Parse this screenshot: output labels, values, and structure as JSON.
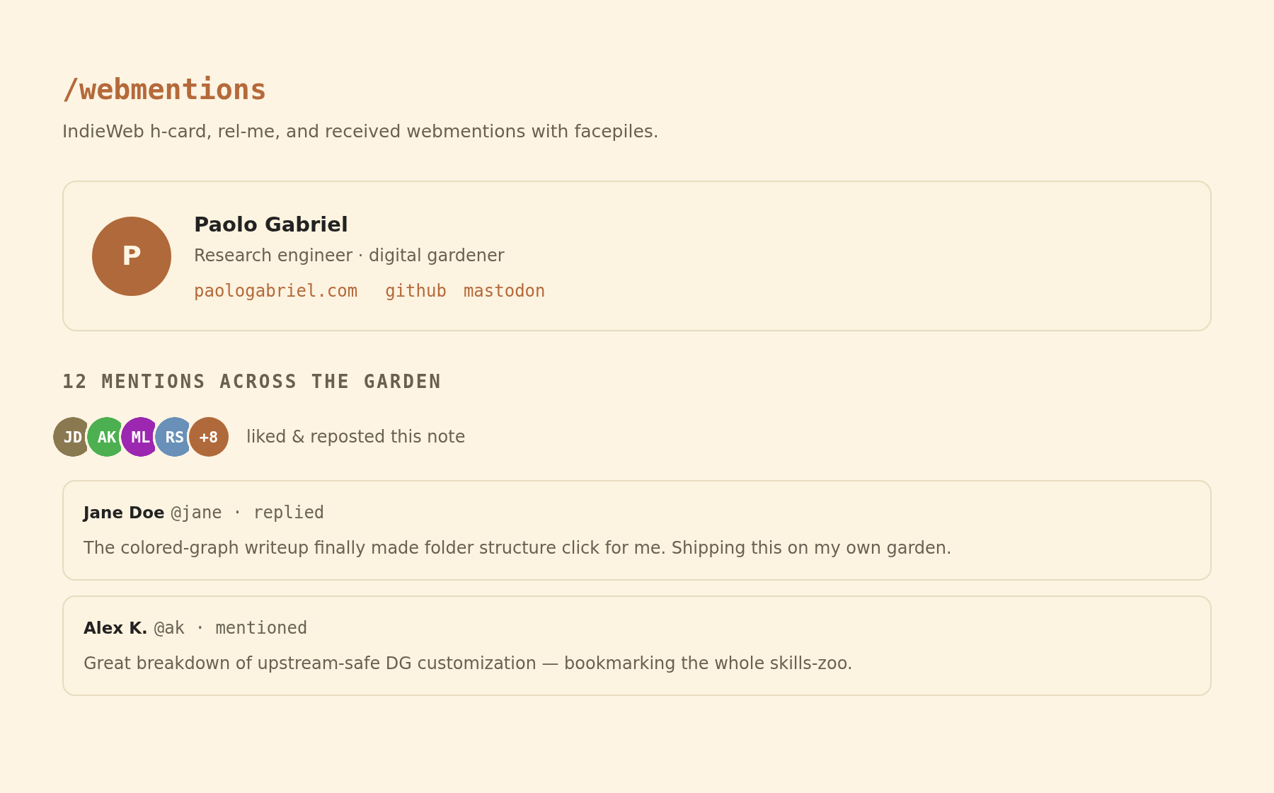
{
  "header": {
    "title": "/webmentions",
    "subtitle": "IndieWeb h-card, rel-me, and received webmentions with facepiles."
  },
  "h_card": {
    "avatar_initial": "P",
    "name": "Paolo Gabriel",
    "note": "Research engineer · digital gardener",
    "url": "paologabriel.com",
    "rel_me": [
      "github",
      "mastodon"
    ]
  },
  "mentions": {
    "heading": "12 MENTIONS ACROSS THE GARDEN",
    "facepile": {
      "avatars": [
        {
          "initials": "JD",
          "color": "#8a7850"
        },
        {
          "initials": "AK",
          "color": "#4caf50"
        },
        {
          "initials": "ML",
          "color": "#9c27b0"
        },
        {
          "initials": "RS",
          "color": "#6890b8"
        }
      ],
      "more": "+8",
      "caption": "liked & reposted this note"
    },
    "replies": [
      {
        "author": "Jane Doe",
        "meta": "@jane · replied",
        "text": "The colored-graph writeup finally made folder structure click for me. Shipping this on my own garden."
      },
      {
        "author": "Alex K.",
        "meta": "@ak · mentioned",
        "text": "Great breakdown of upstream-safe DG customization — bookmarking the whole skills-zoo."
      }
    ]
  }
}
